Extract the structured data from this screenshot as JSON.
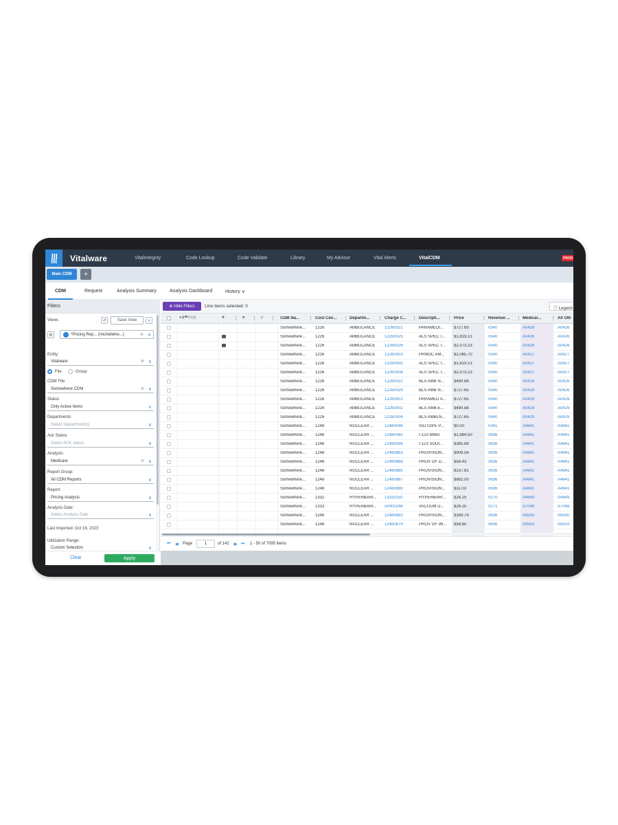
{
  "app": {
    "brand": "Vitalware",
    "prod_badge": "PROD"
  },
  "nav": {
    "items": [
      "VitalIntegrity",
      "Code Lookup",
      "Code Validate",
      "Library",
      "My Advisor",
      "Vital Alerts",
      "VitalCDM"
    ],
    "active": "VitalCDM"
  },
  "tabbar": {
    "main_tab": "Main CDM",
    "add": "+"
  },
  "subtabs": {
    "items": [
      "CDM",
      "Request",
      "Analysis Summary",
      "Analysis Dashboard",
      "History ∨"
    ]
  },
  "sidebar": {
    "title": "Filters",
    "views_label": "Views",
    "save_view": "Save View",
    "view_value": "*Pricing Rep... (michellehe...)",
    "entity_label": "Entity:",
    "entity_value": "Vitalware",
    "radio_file": "File",
    "radio_group": "Group",
    "cdm_file_label": "CDM File:",
    "cdm_file_value": "Somewhere CDM",
    "status_label": "Status",
    "status_value": "Only Active Items",
    "departments_label": "Departments",
    "departments_placeholder": "Select Department(s)",
    "ack_label": "Ack Status",
    "ack_placeholder": "Select ACK status",
    "analysis_label": "Analysis:",
    "analysis_value": "Medicare",
    "report_group_label": "Report Group:",
    "report_group_value": "All CDM Reports",
    "report_label": "Report:",
    "report_value": "Pricing Analysis",
    "analysis_date_label": "Analysis Date:",
    "analysis_date_placeholder": "Select Analysis Date",
    "last_imported": "Last Imported: Oct 18, 2023",
    "utilization_label": "Utilization Range:",
    "utilization_value": "Custom Selection",
    "clear": "Clear",
    "apply": "Apply"
  },
  "toolbar": {
    "hide_filters": "Hide Filters",
    "line_items": "Line items selected: 0",
    "legend": "Legend"
  },
  "grid": {
    "header_icons": "●⧗⚑✕⦸⊗",
    "columns": [
      "CDM Na...",
      "Cost Cen...",
      "Departm...",
      "Charge C...",
      "Descripti...",
      "Price",
      "Revenue ...",
      "Medicar...",
      "All Oth"
    ],
    "rows": [
      [
        "Somewhere...",
        "1226",
        "AMBULANCE",
        "12260021",
        "PARAMEDI...",
        "$727.65",
        "0540",
        "A0426",
        "A0426"
      ],
      [
        "Somewhere...",
        "1226",
        "AMBULANCE",
        "12260025",
        "ALS SPEC T...",
        "$1,819.13",
        "0540",
        "A0426",
        "A0426"
      ],
      [
        "Somewhere...",
        "1226",
        "AMBULANCE",
        "12260026",
        "ALS SPEC T...",
        "$2,073.23",
        "0540",
        "A0426",
        "A0426"
      ],
      [
        "Somewhere...",
        "1226",
        "AMBULANCE",
        "12260003",
        "PRMDC AM...",
        "$1,085.70",
        "0540",
        "A0427",
        "A0427"
      ],
      [
        "Somewhere...",
        "1226",
        "AMBULANCE",
        "12260005",
        "ALS SPEC T...",
        "$1,819.13",
        "0540",
        "A0427",
        "A0427"
      ],
      [
        "Somewhere...",
        "1226",
        "AMBULANCE",
        "12260006",
        "ALS SPEC T...",
        "$2,073.23",
        "0540",
        "A0427",
        "A0427"
      ],
      [
        "Somewhere...",
        "1226",
        "AMBULANCE",
        "12260022",
        "BLS AMB N...",
        "$490.88",
        "0540",
        "A0428",
        "A0428"
      ],
      [
        "Somewhere...",
        "1226",
        "AMBULANCE",
        "12260024",
        "BLS AMB N...",
        "$727.65",
        "0540",
        "A0428",
        "A0428"
      ],
      [
        "Somewhere...",
        "1226",
        "AMBULANCE",
        "12260001",
        "PARAMED A...",
        "$727.65",
        "0540",
        "A0429",
        "A0429"
      ],
      [
        "Somewhere...",
        "1226",
        "AMBULANCE",
        "12260002",
        "BLS AMB-E...",
        "$490.88",
        "0540",
        "A0429",
        "A0429"
      ],
      [
        "Somewhere...",
        "1226",
        "AMBULANCE",
        "12260004",
        "BLS AMBLN...",
        "$727.65",
        "0540",
        "A0429",
        "A0429"
      ],
      [
        "Somewhere...",
        "1248",
        "NUCLEAR ...",
        "12480046",
        "ISOTOPE P...",
        "$0.00",
        "0341",
        "A4641",
        "A4641"
      ],
      [
        "Somewhere...",
        "1248",
        "NUCLEAR ...",
        "12480065",
        "I-123 MIBG",
        "$1,984.50",
        "0636",
        "A4641",
        "A4641"
      ],
      [
        "Somewhere...",
        "1248",
        "NUCLEAR ...",
        "12480066",
        "I-123 SODI...",
        "$385.88",
        "0636",
        "A4641",
        "A4641"
      ],
      [
        "Somewhere...",
        "1248",
        "NUCLEAR ...",
        "12480863",
        "PROVISION...",
        "$909.56",
        "0636",
        "A4641",
        "A4641"
      ],
      [
        "Somewhere...",
        "1248",
        "NUCLEAR ...",
        "12480868",
        "PROV OF D...",
        "$58.43",
        "0636",
        "A4641",
        "A4641"
      ],
      [
        "Somewhere...",
        "1248",
        "NUCLEAR ...",
        "12480885",
        "PROVISION...",
        "$137.81",
        "0636",
        "A4641",
        "A4641"
      ],
      [
        "Somewhere...",
        "1248",
        "NUCLEAR ...",
        "12480887",
        "PROVISION...",
        "$882.00",
        "0636",
        "A4641",
        "A4641"
      ],
      [
        "Somewhere...",
        "1248",
        "NUCLEAR ...",
        "12480888",
        "PROVISION...",
        "$11.03",
        "0636",
        "A4641",
        "A4641"
      ],
      [
        "Somewhere...",
        "1332",
        "HYPERBARI...",
        "13320150",
        "HYPERBARI...",
        "$26.25",
        "0270",
        "A4649",
        "A4649"
      ],
      [
        "Somewhere...",
        "1333",
        "HYPERBARI...",
        "50000246",
        "VACUUM D...",
        "$26.25",
        "0271",
        "A7048",
        "A7048"
      ],
      [
        "Somewhere...",
        "1248",
        "NUCLEAR ...",
        "12480883",
        "PROVISION...",
        "$169.79",
        "0636",
        "A9500",
        "A9500"
      ],
      [
        "Somewhere...",
        "1248",
        "NUCLEAR ...",
        "12480879",
        "PROV OF 99...",
        "$58.85",
        "0636",
        "A9503",
        "A9503"
      ]
    ]
  },
  "pager": {
    "page_label": "Page",
    "page_value": "1",
    "of_pages": "of 142",
    "items": "1 - 50 of 7095 items"
  },
  "colors": {
    "nav_bg": "#2d3a4a",
    "accent": "#2f86d6",
    "apply": "#2eaa5f",
    "hide_filters": "#6a3fb5",
    "prod": "#e0262a"
  }
}
